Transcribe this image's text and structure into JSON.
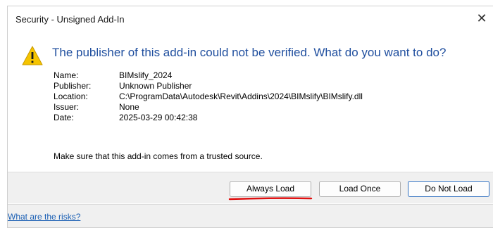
{
  "window": {
    "title": "Security - Unsigned Add-In",
    "close_glyph": "✕"
  },
  "icons": {
    "warning": "warning-triangle-icon",
    "close": "close-icon"
  },
  "message": {
    "heading": "The publisher of this add-in could not be verified. What do you want to do?",
    "details": [
      {
        "label": "Name:",
        "value": "BIMslify_2024"
      },
      {
        "label": "Publisher:",
        "value": "Unknown Publisher"
      },
      {
        "label": "Location:",
        "value": "C:\\ProgramData\\Autodesk\\Revit\\Addins\\2024\\BIMslify\\BIMslify.dll"
      },
      {
        "label": "Issuer:",
        "value": "None"
      },
      {
        "label": "Date:",
        "value": "2025-03-29 00:42:38"
      }
    ],
    "note": "Make sure that this add-in comes from a trusted source."
  },
  "buttons": {
    "always_load": "Always Load",
    "load_once": "Load Once",
    "do_not_load": "Do Not Load"
  },
  "footer": {
    "risk_link": "What are the risks?"
  },
  "colors": {
    "heading": "#1f4e9e",
    "warning_fill": "#f5c400",
    "annotation_red": "#e01010",
    "link": "#1a5fb4"
  }
}
